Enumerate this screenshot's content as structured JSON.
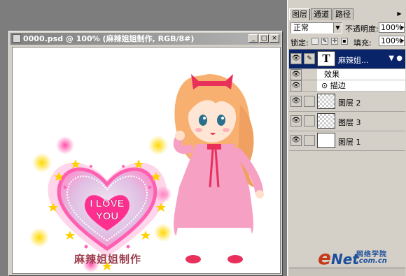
{
  "document": {
    "title": "0000.psd @ 100% (麻辣姐姐制作, RGB/8#)",
    "minimize": "_",
    "maximize": "□",
    "close": "×",
    "artwork": {
      "heart_text_line1": "I LOVE",
      "heart_text_line2": "YOU",
      "caption": "麻辣姐姐制作"
    }
  },
  "layers_panel": {
    "tabs": [
      {
        "label": "图层",
        "active": true
      },
      {
        "label": "通道",
        "active": false
      },
      {
        "label": "路径",
        "active": false
      }
    ],
    "blend_mode": "正常",
    "opacity_label": "不透明度:",
    "opacity_value": "100%",
    "lock_label": "锁定:",
    "fill_label": "填充:",
    "fill_value": "100%",
    "layers": [
      {
        "name": "麻辣姐...",
        "type": "text",
        "thumb": "T",
        "selected": true
      },
      {
        "name": "图层 2",
        "type": "pixel",
        "selected": false
      },
      {
        "name": "图层 3",
        "type": "pixel",
        "selected": false
      },
      {
        "name": "图层 1",
        "type": "pixel",
        "selected": false
      }
    ],
    "effects_label": "效果",
    "stroke_label": "描边"
  },
  "watermark": {
    "e": "e",
    "net": "Net",
    "cn": "网络学院",
    "url": ".com.cn"
  },
  "colors": {
    "selected_layer": "#0a246a",
    "panel_bg": "#d4d0c8",
    "workspace_bg": "#7d7d7d"
  }
}
